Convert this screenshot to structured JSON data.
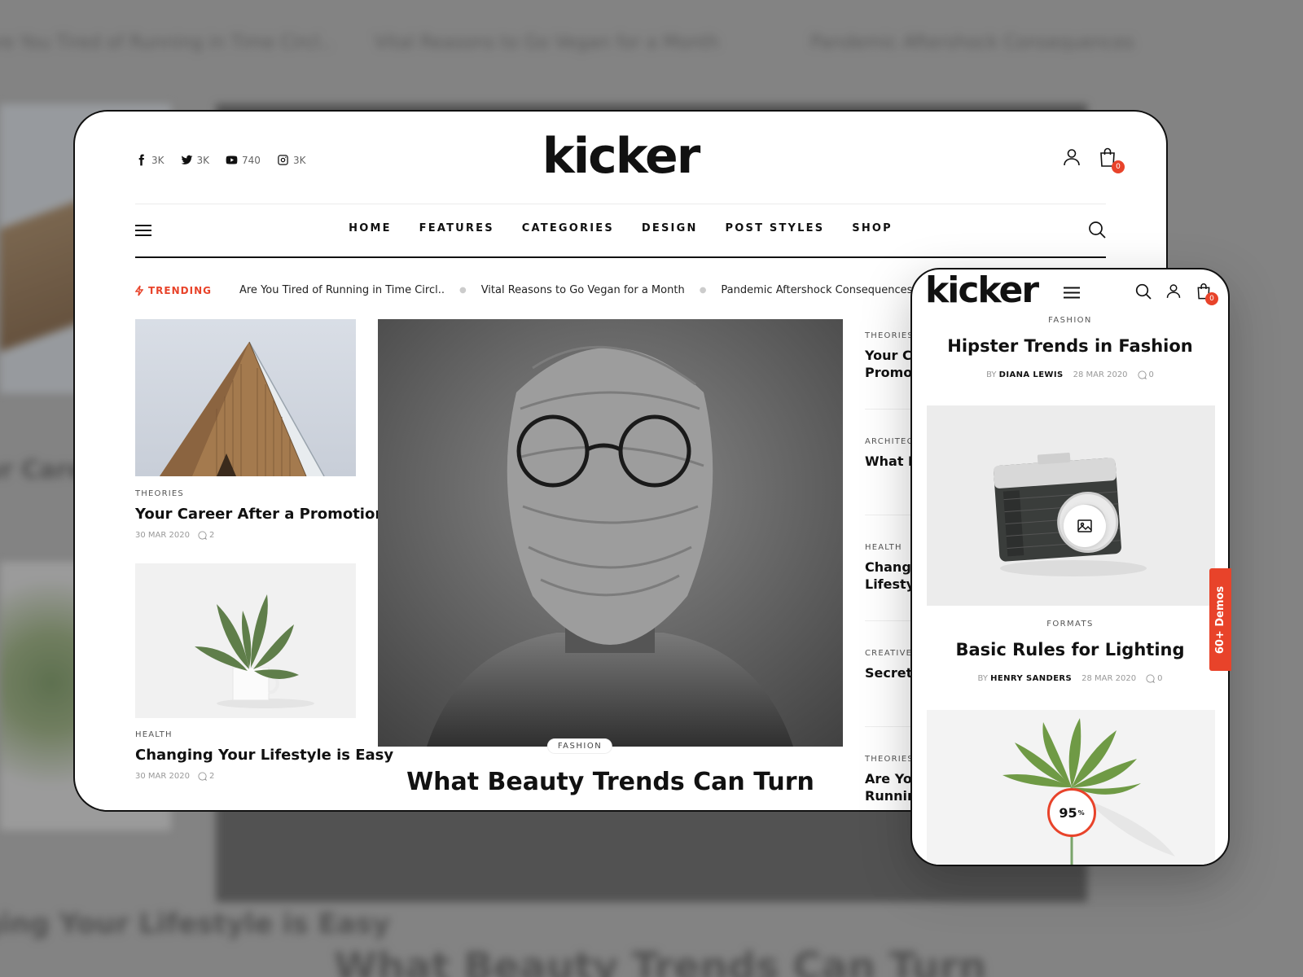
{
  "colors": {
    "accent": "#e8432a",
    "text": "#111111",
    "muted": "#999999"
  },
  "brand": {
    "logo": "kicker"
  },
  "social": [
    {
      "icon": "facebook-icon",
      "count": "3K"
    },
    {
      "icon": "twitter-icon",
      "count": "3K"
    },
    {
      "icon": "youtube-icon",
      "count": "740"
    },
    {
      "icon": "instagram-icon",
      "count": "3K"
    }
  ],
  "cart": {
    "count": "0"
  },
  "nav": {
    "items": [
      "HOME",
      "FEATURES",
      "CATEGORIES",
      "DESIGN",
      "POST STYLES",
      "SHOP"
    ]
  },
  "trending": {
    "label": "TRENDING",
    "items": [
      "Are You Tired of Running in Time Circl..",
      "Vital Reasons to Go Vegan for a Month",
      "Pandemic Aftershock Consequences"
    ]
  },
  "left_posts": [
    {
      "category": "THEORIES",
      "title": "Your Career After a Promotion",
      "date": "30 MAR 2020",
      "comments": "2"
    },
    {
      "category": "HEALTH",
      "title": "Changing Your Lifestyle is Easy",
      "date": "30 MAR 2020",
      "comments": "2"
    }
  ],
  "hero": {
    "category": "FASHION",
    "title": "What Beauty Trends Can Turn"
  },
  "side_posts": [
    {
      "category": "THEORIES",
      "title": "Your Career After a Promotion"
    },
    {
      "category": "ARCHITECTURE",
      "title": "What Design Solves"
    },
    {
      "category": "HEALTH",
      "title": "Changing Your Lifestyle"
    },
    {
      "category": "CREATIVE",
      "title": "Secret Projects"
    },
    {
      "category": "THEORIES",
      "title": "Are You Tired of Running in Circles"
    }
  ],
  "mobile": {
    "post1": {
      "category": "FASHION",
      "title": "Hipster Trends in Fashion",
      "by": "BY",
      "author": "DIANA LEWIS",
      "date": "28 MAR 2020",
      "comments": "0"
    },
    "post2": {
      "category": "FORMATS",
      "title": "Basic Rules for Lighting",
      "by": "BY",
      "author": "HENRY SANDERS",
      "date": "28 MAR 2020",
      "comments": "0"
    },
    "score": "95",
    "score_unit": "%"
  },
  "demos_tab": "60+ Demos"
}
